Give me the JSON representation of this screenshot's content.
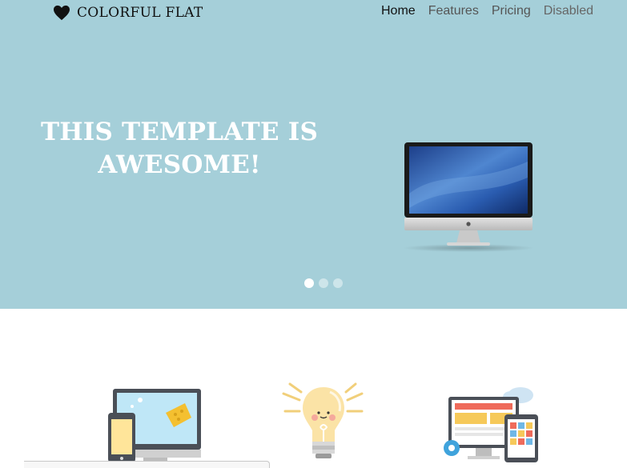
{
  "brand": {
    "name": "COLORFUL FLAT",
    "icon": "heart-icon"
  },
  "nav": {
    "items": [
      {
        "label": "Home",
        "state": "active"
      },
      {
        "label": "Features",
        "state": "normal"
      },
      {
        "label": "Pricing",
        "state": "normal"
      },
      {
        "label": "Disabled",
        "state": "disabled"
      }
    ]
  },
  "hero": {
    "headline_line1": "THIS TEMPLATE IS",
    "headline_line2": "AWESOME!",
    "image": "desktop-monitor-icon",
    "background": "#a5cfd9",
    "carousel": {
      "slides": 3,
      "active": 1
    }
  },
  "features": {
    "icons": [
      "responsive-devices-icon",
      "lightbulb-icon",
      "multi-device-layout-icon"
    ]
  }
}
